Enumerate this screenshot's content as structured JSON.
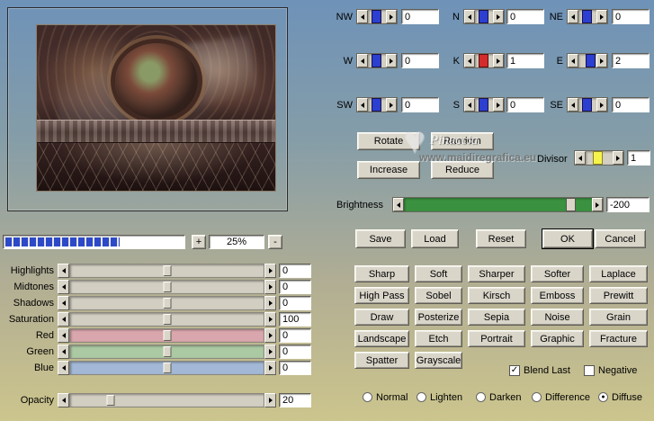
{
  "colors": {
    "accent_blue": "#2c3fd0",
    "accent_red": "#d22c2c",
    "accent_yellow": "#f6f44c",
    "brightness_green": "#3a9140",
    "background_top": "#6e92b8",
    "background_bottom": "#ccc58d"
  },
  "icons": {
    "heart": "♥",
    "check": "✓",
    "radio_dot": "●"
  },
  "zoom": {
    "in_label": "+",
    "value": "25%",
    "out_label": "-"
  },
  "kernel": {
    "cells": [
      {
        "label": "NW",
        "value": "0"
      },
      {
        "label": "N",
        "value": "0"
      },
      {
        "label": "NE",
        "value": "0"
      },
      {
        "label": "W",
        "value": "0"
      },
      {
        "label": "K",
        "value": "1"
      },
      {
        "label": "E",
        "value": "2"
      },
      {
        "label": "SW",
        "value": "0"
      },
      {
        "label": "S",
        "value": "0"
      },
      {
        "label": "SE",
        "value": "0"
      }
    ],
    "rotate_label": "Rotate",
    "random_label": "Random",
    "increase_label": "Increase",
    "reduce_label": "Reduce",
    "divisor": {
      "label": "Divisor",
      "value": "1"
    }
  },
  "watermark": {
    "name": "Pinuccia",
    "url": "www.maidiregrafica.eu"
  },
  "brightness": {
    "label": "Brightness",
    "value": "-200"
  },
  "actions": {
    "save": "Save",
    "load": "Load",
    "reset": "Reset",
    "ok": "OK",
    "cancel": "Cancel"
  },
  "filters": [
    "Sharp",
    "Soft",
    "Sharper",
    "Softer",
    "Laplace",
    "High Pass",
    "Sobel",
    "Kirsch",
    "Emboss",
    "Prewitt",
    "Draw",
    "Posterize",
    "Sepia",
    "Noise",
    "Grain",
    "Landscape",
    "Etch",
    "Portrait",
    "Graphic",
    "Fracture",
    "Spatter",
    "Grayscale"
  ],
  "checkboxes": [
    {
      "label": "Blend Last",
      "checked": true,
      "glyph": "✓"
    },
    {
      "label": "Negative",
      "checked": false,
      "glyph": ""
    }
  ],
  "blend_modes": [
    {
      "label": "Normal",
      "selected": false,
      "glyph": ""
    },
    {
      "label": "Lighten",
      "selected": false,
      "glyph": ""
    },
    {
      "label": "Darken",
      "selected": false,
      "glyph": ""
    },
    {
      "label": "Difference",
      "selected": false,
      "glyph": ""
    },
    {
      "label": "Diffuse",
      "selected": true,
      "glyph": "●"
    }
  ],
  "sliders": [
    {
      "label": "Highlights",
      "value": "0"
    },
    {
      "label": "Midtones",
      "value": "0"
    },
    {
      "label": "Shadows",
      "value": "0"
    },
    {
      "label": "Saturation",
      "value": "100"
    },
    {
      "label": "Red",
      "value": "0"
    },
    {
      "label": "Green",
      "value": "0"
    },
    {
      "label": "Blue",
      "value": "0"
    },
    {
      "label": "Opacity",
      "value": "20"
    }
  ]
}
